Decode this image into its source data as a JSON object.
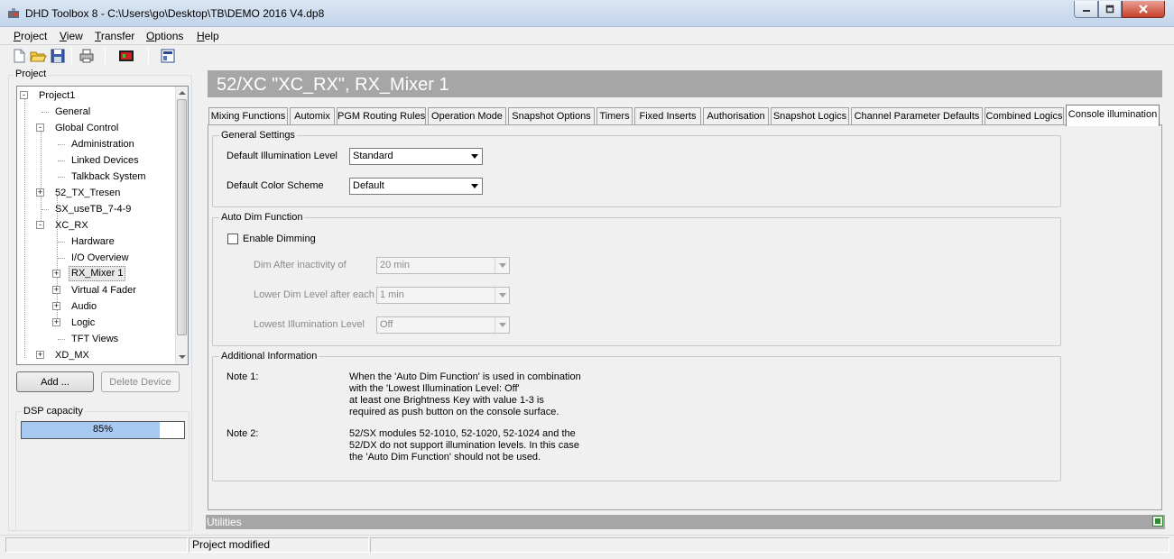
{
  "window": {
    "title": "DHD Toolbox 8 - C:\\Users\\go\\Desktop\\TB\\DEMO 2016 V4.dp8"
  },
  "menu": [
    {
      "label": "Project"
    },
    {
      "label": "View"
    },
    {
      "label": "Transfer"
    },
    {
      "label": "Options"
    },
    {
      "label": "Help"
    }
  ],
  "toolbar": {
    "icons": [
      "new-file-icon",
      "open-folder-icon",
      "save-icon",
      "print-icon",
      "device-icon",
      "properties-icon"
    ]
  },
  "project_panel": {
    "label": "Project",
    "tree": [
      {
        "label": "Project1",
        "expander": "-"
      },
      {
        "label": "General"
      },
      {
        "label": "Global Control",
        "expander": "-"
      },
      {
        "label": "Administration"
      },
      {
        "label": "Linked Devices"
      },
      {
        "label": "Talkback System"
      },
      {
        "label": "52_TX_Tresen",
        "expander": "+"
      },
      {
        "label": "SX_useTB_7-4-9"
      },
      {
        "label": "XC_RX",
        "expander": "-"
      },
      {
        "label": "Hardware"
      },
      {
        "label": "I/O Overview"
      },
      {
        "label": "RX_Mixer 1",
        "expander": "+",
        "selected": true
      },
      {
        "label": "Virtual 4 Fader",
        "expander": "+"
      },
      {
        "label": "Audio",
        "expander": "+"
      },
      {
        "label": "Logic",
        "expander": "+"
      },
      {
        "label": "TFT Views"
      },
      {
        "label": "XD_MX",
        "expander": "+"
      }
    ],
    "add_button": "Add ...",
    "delete_button": "Delete Device"
  },
  "dsp": {
    "label": "DSP capacity",
    "percent_text": "85%",
    "fill": 0.85
  },
  "main": {
    "title": "52/XC \"XC_RX\", RX_Mixer 1",
    "tabs": [
      {
        "label": "Mixing Functions"
      },
      {
        "label": "Automix"
      },
      {
        "label": "PGM Routing Rules"
      },
      {
        "label": "Operation Mode"
      },
      {
        "label": "Snapshot Options"
      },
      {
        "label": "Timers"
      },
      {
        "label": "Fixed Inserts"
      },
      {
        "label": "Authorisation"
      },
      {
        "label": "Snapshot Logics"
      },
      {
        "label": "Channel Parameter Defaults"
      },
      {
        "label": "Combined Logics"
      },
      {
        "label": "Console illumination",
        "active": true
      }
    ],
    "general_settings": {
      "label": "General Settings",
      "illum_label": "Default Illumination Level",
      "illum_value": "Standard",
      "color_label": "Default Color Scheme",
      "color_value": "Default"
    },
    "auto_dim": {
      "label": "Auto Dim Function",
      "enable_label": "Enable Dimming",
      "enabled": false,
      "dim_after_label": "Dim After inactivity of",
      "dim_after_value": "20 min",
      "lower_label": "Lower Dim Level after each",
      "lower_value": "1 min",
      "lowest_label": "Lowest Illumination Level",
      "lowest_value": "Off"
    },
    "additional": {
      "label": "Additional Information",
      "note1_label": "Note 1:",
      "note1_text": "When the 'Auto Dim Function' is used in combination\nwith the 'Lowest Illumination Level: Off'\nat least one Brightness Key with value 1-3 is\nrequired as push button on the console surface.",
      "note2_label": "Note 2:",
      "note2_text": "52/SX modules 52-1010, 52-1020, 52-1024 and the\n52/DX do not support illumination levels. In this case\nthe 'Auto Dim Function' should not be used."
    }
  },
  "utilities": {
    "label": "Utilities"
  },
  "status": {
    "message": "Project modified"
  }
}
